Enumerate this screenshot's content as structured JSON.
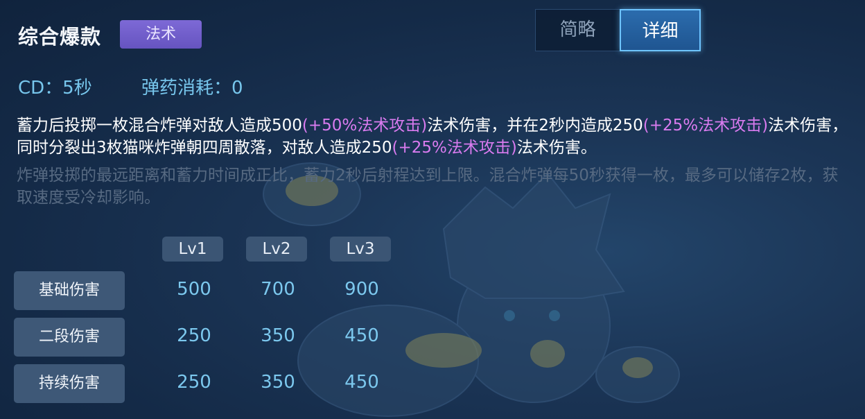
{
  "skill": {
    "name": "综合爆款",
    "type_badge": "法术"
  },
  "view_toggle": {
    "options": [
      "简略",
      "详细"
    ],
    "selected": "详细"
  },
  "stats": {
    "cd": "CD：5秒",
    "ammo_cost": "弹药消耗：0"
  },
  "description": {
    "line1_a": "蓄力后投掷一枚混合炸弹对敌人造成500",
    "line1_b": "(+50%法术攻击)",
    "line1_c": "法术伤害，并在2秒内造成250",
    "line1_d": "(+25%法术攻击)",
    "line1_e": "法术伤害，同时分裂出3枚猫咪炸弹朝四周散落，对敌人造成250",
    "line1_f": "(+25%法术攻击)",
    "line1_g": "法术伤害。",
    "extra": "炸弹投掷的最远距离和蓄力时间成正比，蓄力2秒后射程达到上限。混合炸弹每50秒获得一枚，最多可以储存2枚，获取速度受冷却影响。"
  },
  "colors": {
    "highlight_magic": "#d97bef",
    "stat_value": "#7cc8ee",
    "badge_purple": "#7d69d6",
    "toggle_active_border": "#6ec4ff"
  },
  "level_table": {
    "headers": [
      "Lv1",
      "Lv2",
      "Lv3"
    ],
    "rows": [
      {
        "label": "基础伤害",
        "values": [
          "500",
          "700",
          "900"
        ]
      },
      {
        "label": "二段伤害",
        "values": [
          "250",
          "350",
          "450"
        ]
      },
      {
        "label": "持续伤害",
        "values": [
          "250",
          "350",
          "450"
        ]
      }
    ]
  }
}
